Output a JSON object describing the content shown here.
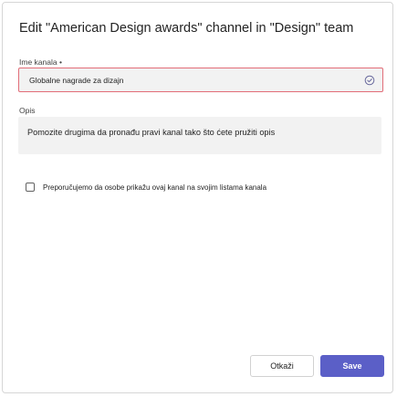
{
  "dialog": {
    "title": "Edit \"American Design awards\" channel in \"Design\" team"
  },
  "form": {
    "name": {
      "label": "Ime kanala •",
      "value": "Globalne nagrade za dizajn",
      "status_icon": "check-circle-icon"
    },
    "description": {
      "label": "Opis",
      "value": "Pomozite drugima da pronađu pravi kanal tako što ćete pružiti opis"
    },
    "recommend": {
      "label": "Preporučujemo da osobe prikažu ovaj kanal na svojim listama kanala",
      "checked": false
    }
  },
  "footer": {
    "cancel_label": "Otkaži",
    "save_label": "Save"
  },
  "colors": {
    "accent": "#5b5fc7",
    "error_border": "#e26d78",
    "input_bg": "#f2f2f2"
  }
}
